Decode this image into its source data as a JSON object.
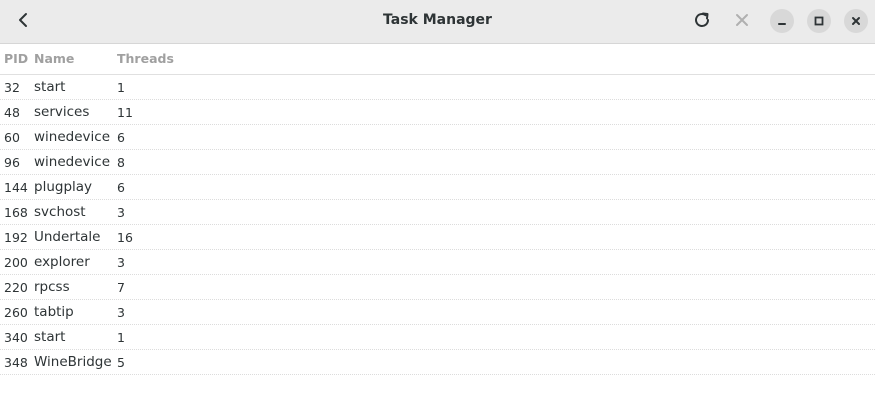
{
  "window": {
    "title": "Task Manager"
  },
  "toolbar": {
    "icons": [
      "back-icon",
      "refresh-icon",
      "kill-icon",
      "minimize-icon",
      "maximize-icon",
      "close-icon"
    ]
  },
  "table": {
    "columns": [
      "PID",
      "Name",
      "Threads"
    ],
    "rows": [
      {
        "pid": "32",
        "name": "start",
        "threads": "1"
      },
      {
        "pid": "48",
        "name": "services",
        "threads": "11"
      },
      {
        "pid": "60",
        "name": "winedevice",
        "threads": "6"
      },
      {
        "pid": "96",
        "name": "winedevice",
        "threads": "8"
      },
      {
        "pid": "144",
        "name": "plugplay",
        "threads": "6"
      },
      {
        "pid": "168",
        "name": "svchost",
        "threads": "3"
      },
      {
        "pid": "192",
        "name": "Undertale",
        "threads": "16"
      },
      {
        "pid": "200",
        "name": "explorer",
        "threads": "3"
      },
      {
        "pid": "220",
        "name": "rpcss",
        "threads": "7"
      },
      {
        "pid": "260",
        "name": "tabtip",
        "threads": "3"
      },
      {
        "pid": "340",
        "name": "start",
        "threads": "1"
      },
      {
        "pid": "348",
        "name": "WineBridge",
        "threads": "5"
      }
    ]
  },
  "colors": {
    "headerbar": "#ebebeb",
    "header_text": "#a0a0a0",
    "kill_disabled": "#b0b0b0",
    "button_bg": "#d8d8d8"
  }
}
